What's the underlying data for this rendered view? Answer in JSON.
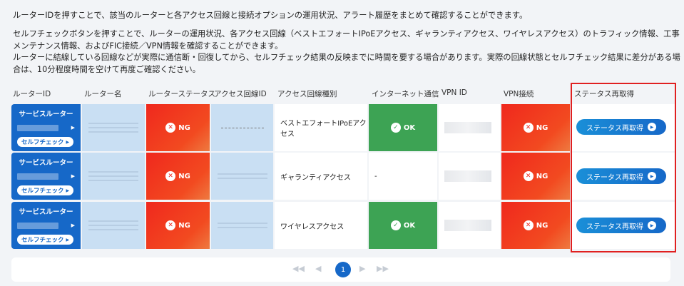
{
  "description": {
    "line1": "ルーターIDを押すことで、該当のルーターと各アクセス回線と接続オプションの運用状況、アラート履歴をまとめて確認することができます。",
    "line2": "セルフチェックボタンを押すことで、ルーターの運用状況、各アクセス回線（ベストエフォートIPoEアクセス、ギャランティアクセス、ワイヤレスアクセス）のトラフィック情報、工事",
    "line3": "メンテナンス情報、およびFIC接続／VPN情報を確認することができます。",
    "line4": "ルーターに結線している回線などが実際に通信断・回復してから、セルフチェック結果の反映までに時間を要する場合があります。実際の回線状態とセルフチェック結果に差分がある場",
    "line5": "合は、10分程度時間を空けて再度ご確認ください。"
  },
  "table": {
    "headers": {
      "router_id": "ルーターID",
      "router_name": "ルーター名",
      "router_status": "ルーターステータス",
      "access_line_id": "アクセス回線ID",
      "access_line_type": "アクセス回線種別",
      "internet": "インターネット通信",
      "vpn_id": "VPN ID",
      "vpn_conn": "VPN接続",
      "refresh": "ステータス再取得"
    },
    "rows": [
      {
        "router_title": "サービスルーター",
        "selfcheck_label": "セルフチェック",
        "router_status": "NG",
        "access_line_type": "ベストエフォートIPoEアクセス",
        "internet": "OK",
        "vpn_conn": "NG",
        "refresh_label": "ステータス再取得"
      },
      {
        "router_title": "サービスルーター",
        "selfcheck_label": "セルフチェック",
        "router_status": "NG",
        "access_line_type": "ギャランティアクセス",
        "internet": "-",
        "vpn_conn": "NG",
        "refresh_label": "ステータス再取得"
      },
      {
        "router_title": "サービスルーター",
        "selfcheck_label": "セルフチェック",
        "router_status": "NG",
        "access_line_type": "ワイヤレスアクセス",
        "internet": "OK",
        "vpn_conn": "NG",
        "refresh_label": "ステータス再取得"
      }
    ]
  },
  "pagination": {
    "current_page": "1"
  },
  "icons": {
    "first": "double-left-icon",
    "prev": "left-icon",
    "next": "right-icon",
    "last": "double-right-icon"
  },
  "colors": {
    "router_blue": "#1668c8",
    "ng_red": "#f0281d",
    "ok_green": "#3da354",
    "highlight": "#e02020"
  }
}
